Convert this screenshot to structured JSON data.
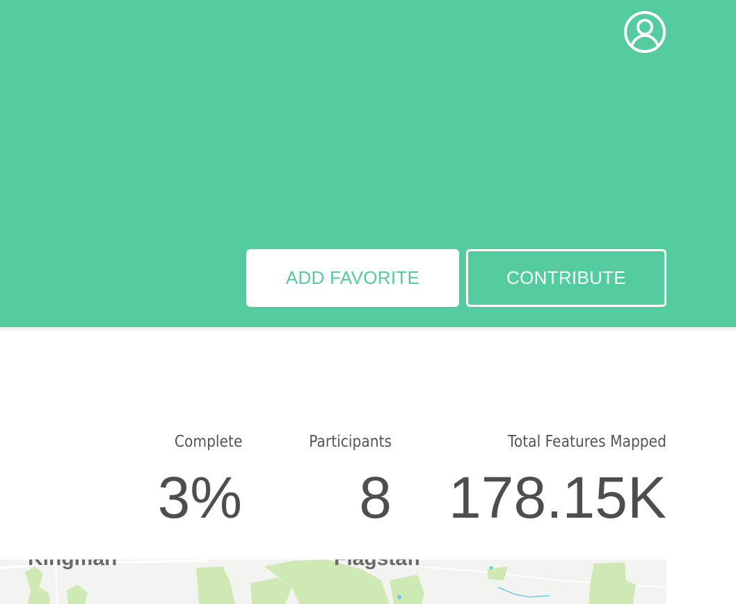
{
  "header": {
    "background_color": "#55cba0",
    "user_icon": "user-circle-icon",
    "add_favorite_label": "ADD FAVORITE",
    "contribute_label": "CONTRIBUTE"
  },
  "stats": {
    "complete": {
      "label": "Complete",
      "value": "3%"
    },
    "participants": {
      "label": "Participants",
      "value": "8"
    },
    "total_features": {
      "label": "Total Features Mapped",
      "value": "178.15K"
    }
  },
  "map": {
    "labels": [
      "Kingman",
      "Flagstaff"
    ]
  }
}
